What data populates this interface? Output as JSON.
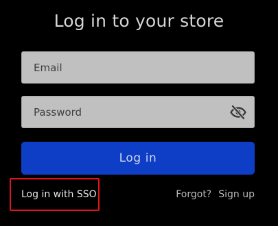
{
  "page": {
    "title": "Log in to your store"
  },
  "form": {
    "email_placeholder": "Email",
    "email_value": "",
    "password_placeholder": "Password",
    "password_value": "",
    "password_toggle_icon": "eye-slash-icon",
    "login_label": "Log in"
  },
  "links": {
    "sso_label": "Log in with SSO",
    "forgot_label": "Forgot?",
    "signup_label": "Sign up"
  },
  "colors": {
    "background": "#000000",
    "primary_button": "#0e3ec6",
    "field_background": "#c0c0c0",
    "highlight_box": "#e0141c"
  }
}
